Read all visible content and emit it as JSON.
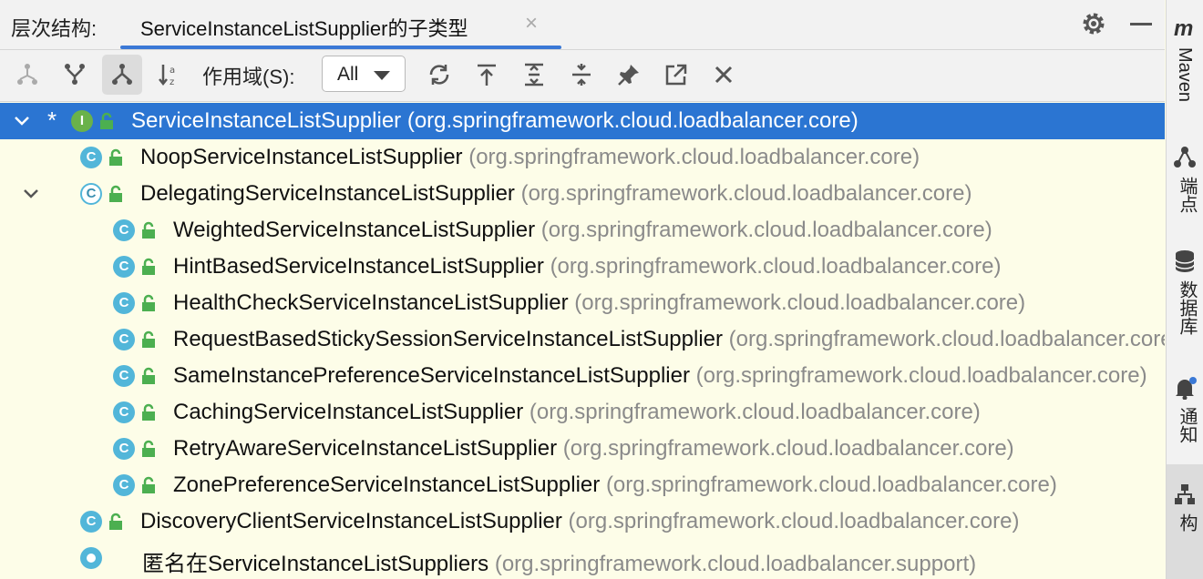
{
  "header": {
    "label": "层次结构:",
    "tab_title": "ServiceInstanceListSupplier的子类型",
    "tab_close": "×"
  },
  "toolbar": {
    "scope_label": "作用域(S):",
    "scope_value": "All"
  },
  "tree": [
    {
      "name": "ServiceInstanceListSupplier",
      "pkg": "(org.springframework.cloud.loadbalancer.core)",
      "kind": "interface",
      "star": "*"
    },
    {
      "name": "NoopServiceInstanceListSupplier",
      "pkg": "(org.springframework.cloud.loadbalancer.core)",
      "kind": "class"
    },
    {
      "name": "DelegatingServiceInstanceListSupplier",
      "pkg": "(org.springframework.cloud.loadbalancer.core)",
      "kind": "abstract"
    },
    {
      "name": "WeightedServiceInstanceListSupplier",
      "pkg": "(org.springframework.cloud.loadbalancer.core)",
      "kind": "class"
    },
    {
      "name": "HintBasedServiceInstanceListSupplier",
      "pkg": "(org.springframework.cloud.loadbalancer.core)",
      "kind": "class"
    },
    {
      "name": "HealthCheckServiceInstanceListSupplier",
      "pkg": "(org.springframework.cloud.loadbalancer.core)",
      "kind": "class"
    },
    {
      "name": "RequestBasedStickySessionServiceInstanceListSupplier",
      "pkg": "(org.springframework.cloud.loadbalancer.core)",
      "kind": "class"
    },
    {
      "name": "SameInstancePreferenceServiceInstanceListSupplier",
      "pkg": "(org.springframework.cloud.loadbalancer.core)",
      "kind": "class"
    },
    {
      "name": "CachingServiceInstanceListSupplier",
      "pkg": "(org.springframework.cloud.loadbalancer.core)",
      "kind": "class"
    },
    {
      "name": "RetryAwareServiceInstanceListSupplier",
      "pkg": "(org.springframework.cloud.loadbalancer.core)",
      "kind": "class"
    },
    {
      "name": "ZonePreferenceServiceInstanceListSupplier",
      "pkg": "(org.springframework.cloud.loadbalancer.core)",
      "kind": "class"
    },
    {
      "name": "DiscoveryClientServiceInstanceListSupplier",
      "pkg": "(org.springframework.cloud.loadbalancer.core)",
      "kind": "class"
    },
    {
      "name": "匿名在ServiceInstanceListSuppliers",
      "pkg": "(org.springframework.cloud.loadbalancer.support)",
      "kind": "anonymous"
    }
  ],
  "icon_letters": {
    "class": "C",
    "interface": "I",
    "abstract": "C"
  },
  "rightbar": {
    "maven": "Maven",
    "endpoints": "端点",
    "database": "数据库",
    "notifications": "通知",
    "hierarchy": "层次结构"
  },
  "colors": {
    "selection": "#2b75d2",
    "class_icon": "#52b6d9",
    "interface_icon": "#6ab24a",
    "lock": "#4caf50"
  }
}
